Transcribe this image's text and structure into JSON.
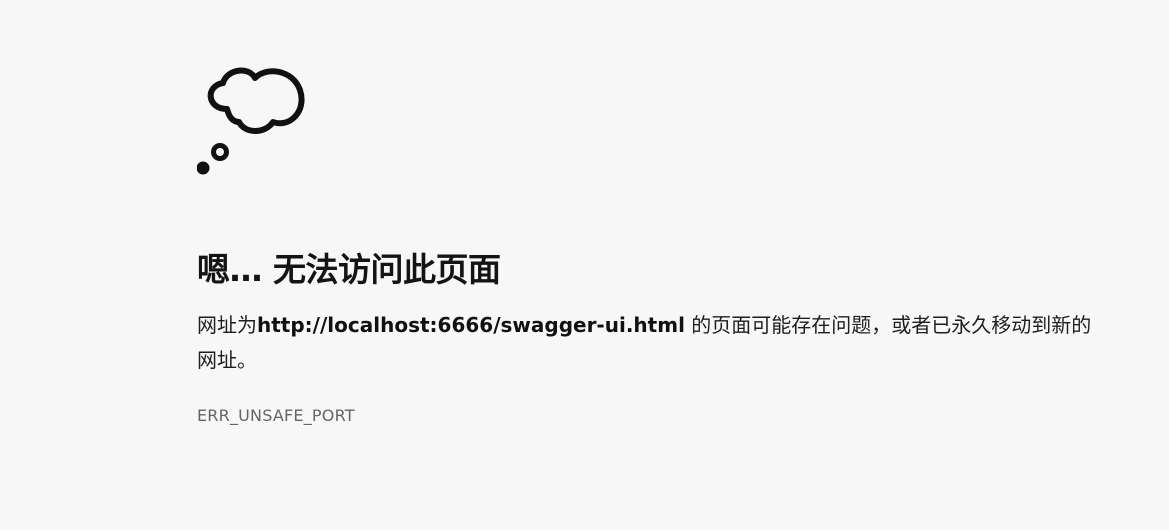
{
  "error_page": {
    "title": "嗯… 无法访问此页面",
    "description_prefix": "网址为",
    "url": "http://localhost:6666/swagger-ui.html",
    "description_suffix": " 的页面可能存在问题，或者已永久移动到新的网址。",
    "error_code": "ERR_UNSAFE_PORT",
    "icon": "thought-cloud-icon"
  }
}
